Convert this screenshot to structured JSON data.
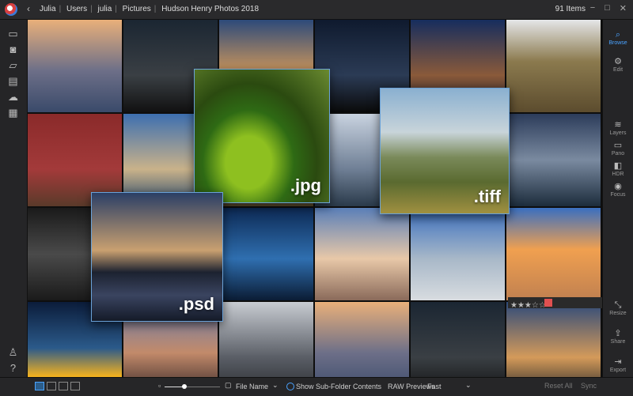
{
  "titlebar": {
    "back_icon": "chevron-left",
    "breadcrumbs": [
      "Julia",
      "Users",
      "julia",
      "Pictures",
      "Hudson Henry Photos 2018"
    ],
    "item_count": "91 Items",
    "window_buttons": [
      "−",
      "□",
      "✕"
    ]
  },
  "left_sidebar": {
    "icons": [
      "monitor-icon",
      "camera-icon",
      "folder-icon",
      "drive-icon",
      "cloud-icon",
      "stack-icon",
      "person-icon",
      "help-icon"
    ]
  },
  "right_toolbar": {
    "tools": [
      {
        "name": "browse",
        "label": "Browse",
        "glyph": "⌕",
        "active": true
      },
      {
        "name": "edit",
        "label": "Edit",
        "glyph": "⚙",
        "active": false
      },
      {
        "name": "layers",
        "label": "Layers",
        "glyph": "≋",
        "active": false
      },
      {
        "name": "pano",
        "label": "Pano",
        "glyph": "▭",
        "active": false
      },
      {
        "name": "hdr",
        "label": "HDR",
        "glyph": "◧",
        "active": false
      },
      {
        "name": "focus",
        "label": "Focus",
        "glyph": "◉",
        "active": false
      },
      {
        "name": "resize",
        "label": "Resize",
        "glyph": "⤡",
        "active": false
      },
      {
        "name": "share",
        "label": "Share",
        "glyph": "⇪",
        "active": false
      },
      {
        "name": "export",
        "label": "Export",
        "glyph": "⇥",
        "active": false
      }
    ]
  },
  "grid": {
    "tiles": [
      {
        "bg": "linear-gradient(#e9b07a,#6d6f88 55%,#3a4a6a)"
      },
      {
        "bg": "linear-gradient(#1b2632,#3a3f44 60%,#111)"
      },
      {
        "bg": "linear-gradient(#2d4a7a,#d49a5a 60%,#2a2a2a)"
      },
      {
        "bg": "linear-gradient(#0f1a2e,#2b3b55 60%,#0a0a0a)"
      },
      {
        "bg": "linear-gradient(#162d5e,#8a5a3a 60%,#1a1a2a)"
      },
      {
        "bg": "linear-gradient(#e5e6e8,#8b7a4e 45%,#5c4c2e)"
      },
      {
        "bg": "linear-gradient(#8a2a2a,#a33a3a 60%,#5a3a2a)"
      },
      {
        "bg": "linear-gradient(#3d6fb0,#c9b28a 60%,#2c4c6e)"
      },
      {
        "bg": "linear-gradient(#2c2f3a,#c0a070 60%,#5a4a2a)"
      },
      {
        "bg": "linear-gradient(#c9d3e0,#6f7f95 60%,#2a3a4a)"
      },
      {
        "bg": "linear-gradient(#1e3145,#d58a4a 40%,#0f1a24)"
      },
      {
        "bg": "linear-gradient(#2c3c5a,#7a8aa0 50%,#1c2c3c)"
      },
      {
        "bg": "linear-gradient(#1a1a1a,#4a4a4a 50%,#1a1a1a)"
      },
      {
        "bg": "linear-gradient(#1c1c1c,#5a4a3a 50%,#0c0c0c)"
      },
      {
        "bg": "linear-gradient(#0d2a55,#2f6fb0 55%,#0b1c34)"
      },
      {
        "bg": "linear-gradient(#5a7fb8,#e8c8a8 55%,#8a6a5a)"
      },
      {
        "bg": "linear-gradient(#3a6fc0,#a8b8c8 55%,#d8dce0)"
      },
      {
        "bg": "linear-gradient(#3a6fc0,#f0a050 45%,#c08050)"
      },
      {
        "bg": "linear-gradient(#0b1c3a,#2b5a8a 50%,#f0b020 80%)"
      },
      {
        "bg": "linear-gradient(#6a7fb0,#c28a6a 55%,#3a2a2a)"
      },
      {
        "bg": "linear-gradient(#c8ccd2,#5a5e66 60%,#2a2c30)"
      }
    ],
    "overlays": [
      {
        "name": "jpg-preview",
        "label": ".jpg",
        "bg": "radial-gradient(ellipse at 40% 70%, #8ec020 0 20%, #2e6a14 40%, #2b4a10 60%, #6a8a30 100%)"
      },
      {
        "name": "tiff-preview",
        "label": ".tiff",
        "bg": "linear-gradient(#8ab0d0,#c8d4da 35%,#7a8a5a 55%,#5a6a30 75%,#a09040)"
      },
      {
        "name": "psd-preview",
        "label": ".psd",
        "bg": "linear-gradient(#2b3f66,#c9a070 45%,#1c2230 62%,#3a4460 80%,#141a28)"
      }
    ],
    "rating": {
      "stars": "★★★☆☆",
      "flag_color": "#e05050"
    }
  },
  "bottombar": {
    "view_modes": [
      "grid-view",
      "single-view",
      "compare-view",
      "filmstrip-view"
    ],
    "sort_label": "File Name",
    "subfolder_label": "Show Sub-Folder Contents",
    "raw_label": "RAW Previews",
    "raw_value": "Fast",
    "reset_all": "Reset All",
    "sync": "Sync",
    "zoom": 0.35
  }
}
